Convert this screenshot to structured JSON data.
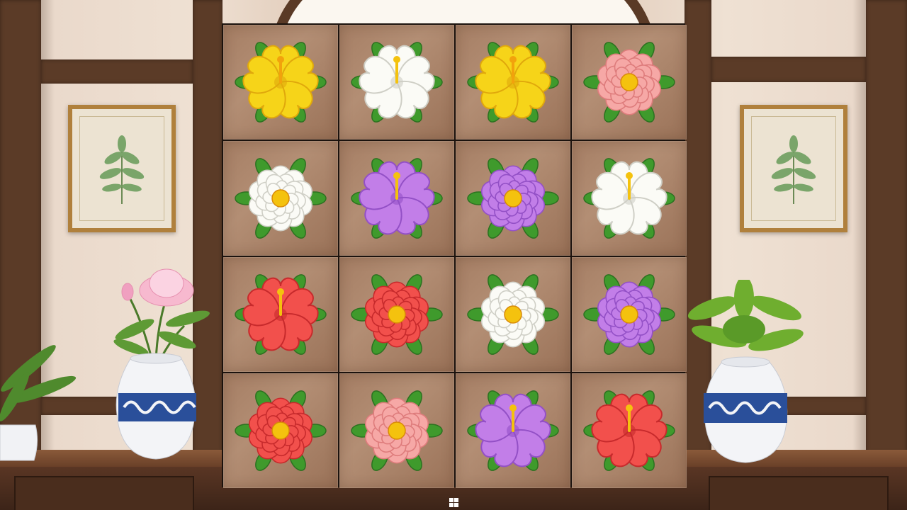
{
  "game": {
    "board": {
      "rows": 4,
      "cols": 4,
      "tiles": [
        {
          "flower": "hibiscus",
          "color": "yellow"
        },
        {
          "flower": "hibiscus",
          "color": "white"
        },
        {
          "flower": "hibiscus",
          "color": "yellow"
        },
        {
          "flower": "camellia",
          "color": "pink"
        },
        {
          "flower": "camellia",
          "color": "white"
        },
        {
          "flower": "hibiscus",
          "color": "purple"
        },
        {
          "flower": "camellia",
          "color": "purple"
        },
        {
          "flower": "hibiscus",
          "color": "white"
        },
        {
          "flower": "hibiscus",
          "color": "red"
        },
        {
          "flower": "camellia",
          "color": "red"
        },
        {
          "flower": "camellia",
          "color": "white"
        },
        {
          "flower": "camellia",
          "color": "purple"
        },
        {
          "flower": "camellia",
          "color": "red"
        },
        {
          "flower": "camellia",
          "color": "pink"
        },
        {
          "flower": "hibiscus",
          "color": "purple"
        },
        {
          "flower": "hibiscus",
          "color": "red"
        }
      ]
    }
  },
  "palette": {
    "yellow": {
      "petal": "#f6d419",
      "shade": "#e0a80c",
      "center": "#f2a20c"
    },
    "white": {
      "petal": "#fbfbf6",
      "shade": "#cfcfc6",
      "center": "#f4c20e"
    },
    "pink": {
      "petal": "#f6a8a6",
      "shade": "#de7c7c",
      "center": "#f4c20e"
    },
    "purple": {
      "petal": "#c27ee8",
      "shade": "#9350c6",
      "center": "#f4c20e"
    },
    "red": {
      "petal": "#f2504c",
      "shade": "#c72a2c",
      "center": "#f4c20e"
    },
    "leaf": "#3f9a2c",
    "leaf_dark": "#2c7120"
  },
  "icons": {
    "taskbar": "windows-start-icon"
  }
}
